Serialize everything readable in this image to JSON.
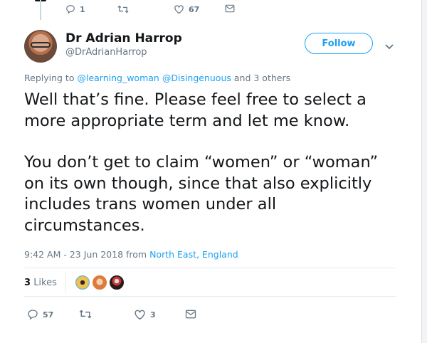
{
  "top_actions": {
    "reply_count": "1",
    "retweet_count": "",
    "like_count": "67"
  },
  "author": {
    "name": "Dr Adrian Harrop",
    "handle": "@DrAdrianHarrop"
  },
  "follow_label": "Follow",
  "reply_to": {
    "prefix": "Replying to",
    "user1": "@learning_woman",
    "user2": "@Disingenuous",
    "suffix": "and 3 others"
  },
  "tweet": {
    "paragraph1": "Well that’s fine. Please feel free to select a more appropriate term and let me know.",
    "paragraph2": "You don’t get to claim “women” or “woman” on its own though, since that also explicitly includes trans women under all circumstances."
  },
  "meta": {
    "timestamp": "9:42 AM - 23 Jun 2018 from",
    "location": "North East, England"
  },
  "likes": {
    "count": "3",
    "label": "Likes"
  },
  "bottom_actions": {
    "reply_count": "57",
    "retweet_count": "",
    "like_count": "3"
  },
  "colors": {
    "accent": "#1da1f2",
    "secondary_text": "#657786",
    "primary_text": "#14171a"
  },
  "icons": [
    "reply-icon",
    "retweet-icon",
    "heart-icon",
    "message-icon",
    "chevron-down-icon"
  ]
}
